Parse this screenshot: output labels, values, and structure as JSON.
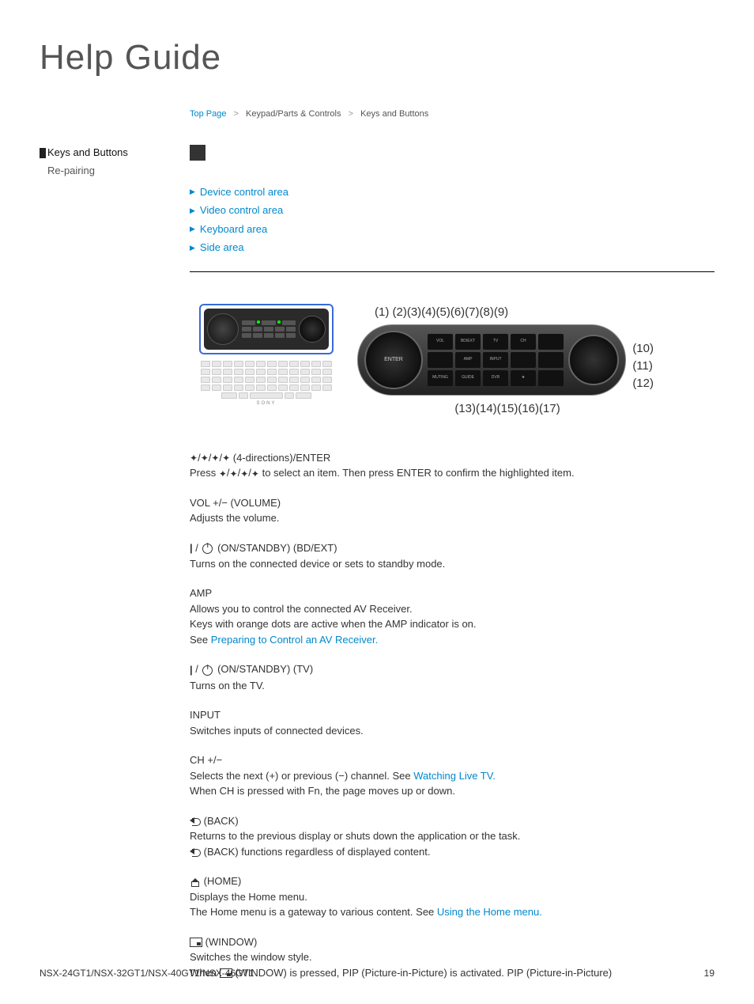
{
  "page_title": "Help Guide",
  "breadcrumb": {
    "top": "Top Page",
    "sep": ">",
    "cat": "Keypad/Parts & Controls",
    "cur": "Keys and Buttons"
  },
  "sidebar": {
    "current": "Keys and Buttons",
    "other": "Re-pairing"
  },
  "anchors": [
    "Device control area",
    "Video control area",
    "Keyboard area",
    "Side area"
  ],
  "diagram": {
    "top_callouts": "(1)   (2)(3)(4)(5)(6)(7)(8)(9)",
    "right_callouts": [
      "(10)",
      "(11)",
      "(12)"
    ],
    "bottom_callouts": "(13)(14)(15)(16)(17)",
    "keyboard_brand": "SONY",
    "enter_label": "ENTER",
    "zoom_labels": [
      "VOL",
      "BD/EXT",
      "AMP",
      "TV",
      "INPUT",
      "CH",
      "MUTING",
      "GUIDE",
      "DVR",
      "★"
    ]
  },
  "items": {
    "i1": {
      "title_suffix": " (4-directions)/ENTER",
      "body_pre": "Press ",
      "body_post": " to select an item. Then press ENTER to confirm the highlighted item."
    },
    "i2": {
      "title": "VOL +/− (VOLUME)",
      "body": "Adjusts the volume."
    },
    "i3": {
      "title_pre": "",
      "title_post": " (ON/STANDBY) (BD/EXT)",
      "body": "Turns on the connected device or sets to standby mode."
    },
    "i4": {
      "title": "AMP",
      "l1": "Allows you to control the connected AV Receiver.",
      "l2": "Keys with orange dots are active when the AMP indicator is on.",
      "l3_pre": "See ",
      "l3_link": "Preparing to Control an AV Receiver."
    },
    "i5": {
      "title_post": " (ON/STANDBY) (TV)",
      "body": "Turns on the TV."
    },
    "i6": {
      "title": "INPUT",
      "body": "Switches inputs of connected devices."
    },
    "i7": {
      "title": "CH +/−",
      "l1_pre": "Selects the next (+) or previous (−) channel. See ",
      "l1_link": "Watching Live TV.",
      "l2": "When CH is pressed with Fn, the page moves up or down."
    },
    "i8": {
      "title_post": " (BACK)",
      "l1": "Returns to the previous display or shuts down the application or the task.",
      "l2_post": " (BACK) functions regardless of displayed content."
    },
    "i9": {
      "title_post": " (HOME)",
      "l1": "Displays the Home menu.",
      "l2_pre": "The Home menu is a gateway to various content. See ",
      "l2_link": "Using the Home menu."
    },
    "i10": {
      "title_post": " (WINDOW)",
      "l1": "Switches the window style.",
      "l2_pre": "When ",
      "l2_post": " (WINDOW) is pressed, PIP (Picture-in-Picture) is activated. PIP (Picture-in-Picture)"
    }
  },
  "footer": {
    "models": "NSX-24GT1/NSX-32GT1/NSX-40GT1/NSX-46GT1",
    "page": "19"
  }
}
